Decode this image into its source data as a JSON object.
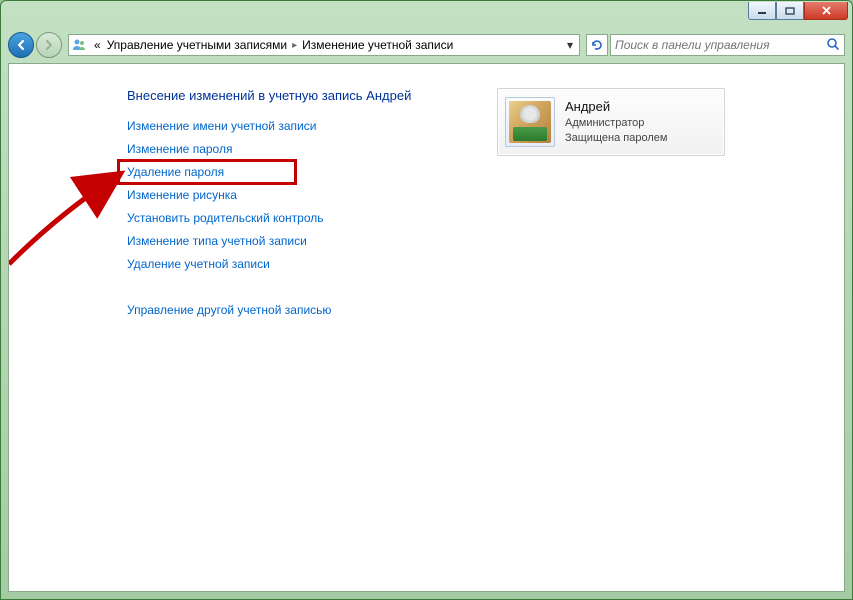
{
  "breadcrumb": {
    "seg1": "Управление учетными записями",
    "seg2": "Изменение учетной записи"
  },
  "search": {
    "placeholder": "Поиск в панели управления"
  },
  "page": {
    "heading": "Внесение изменений в учетную запись Андрей"
  },
  "links": {
    "rename": "Изменение имени учетной записи",
    "change_pw": "Изменение пароля",
    "delete_pw": "Удаление пароля",
    "change_pic": "Изменение рисунка",
    "parental": "Установить родительский контроль",
    "change_type": "Изменение типа учетной записи",
    "delete_acc": "Удаление учетной записи",
    "manage_other": "Управление другой учетной записью"
  },
  "account": {
    "name": "Андрей",
    "role": "Администратор",
    "status": "Защищена паролем"
  }
}
